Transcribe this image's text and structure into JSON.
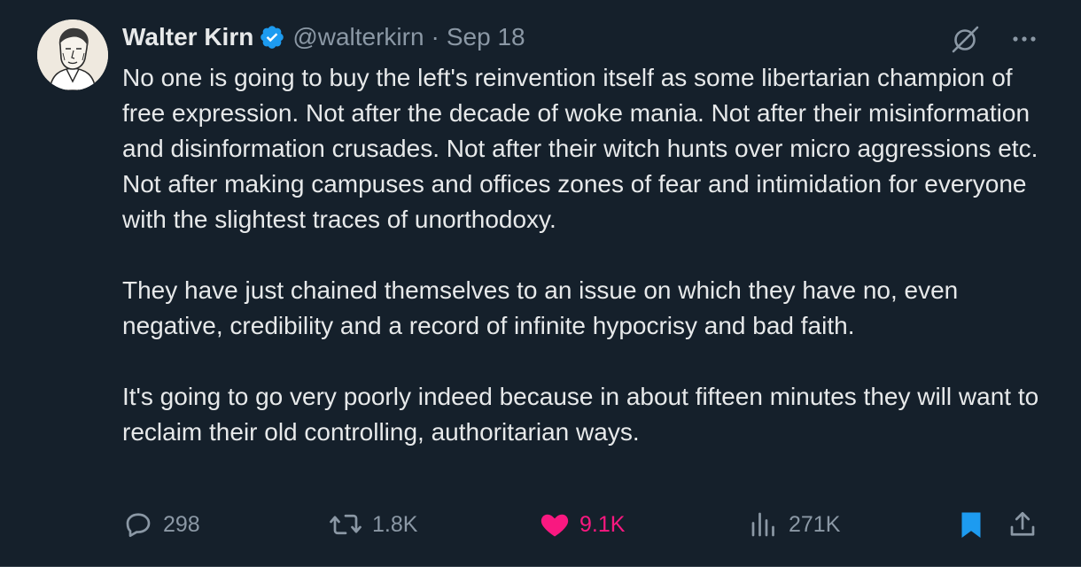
{
  "author": {
    "name": "Walter Kirn",
    "handle": "@walterkirn",
    "separator": "·",
    "date": "Sep 18",
    "verified": true
  },
  "icons": {
    "verified": "verified-badge-icon",
    "grok": "grok-icon",
    "more": "more-options-icon",
    "reply": "reply-icon",
    "retweet": "retweet-icon",
    "like": "heart-icon",
    "views": "views-icon",
    "bookmark": "bookmark-icon",
    "share": "share-icon"
  },
  "tweet": {
    "paragraphs": [
      "No one is going to buy the left's reinvention itself as some libertarian champion of free expression. Not after the decade of woke mania. Not after their misinformation and disinformation crusades. Not after their witch hunts over micro aggressions etc. Not after making campuses and offices zones of fear and intimidation for everyone with the slightest traces of unorthodoxy.",
      "They have just chained themselves to an issue on which they have no, even negative, credibility and a record of infinite hypocrisy and bad faith.",
      "It's going to go very poorly indeed because in about fifteen minutes they will want to reclaim their old controlling, authoritarian ways."
    ]
  },
  "actions": {
    "replies": "298",
    "retweets": "1.8K",
    "likes": "9.1K",
    "views": "271K",
    "liked": true,
    "bookmarked": true
  },
  "colors": {
    "background": "#15202b",
    "text": "#e7e9ea",
    "secondary": "#8b98a5",
    "like": "#f91880",
    "accent": "#1d9bf0"
  }
}
